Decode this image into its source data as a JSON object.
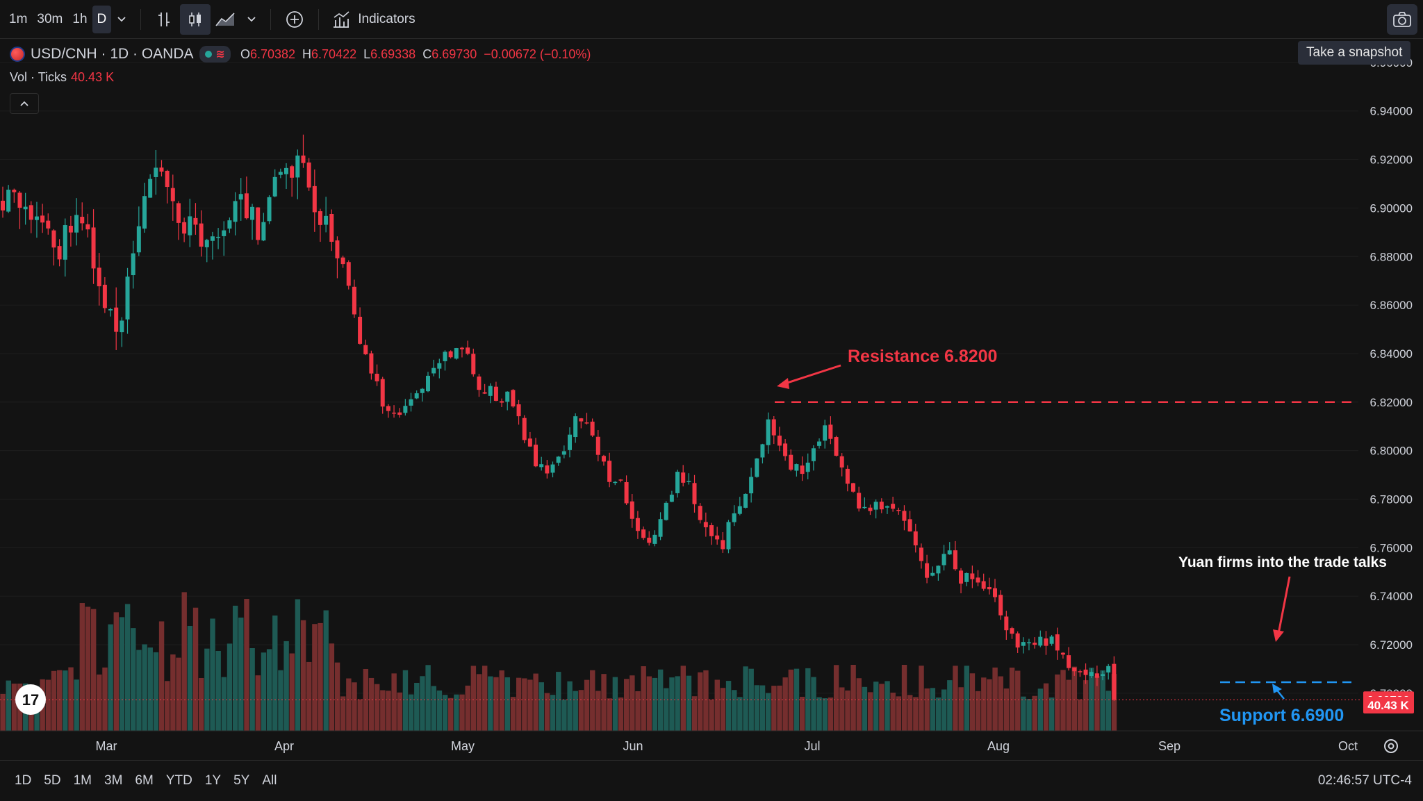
{
  "toolbar": {
    "timeframes": [
      "1m",
      "30m",
      "1h",
      "D"
    ],
    "active_timeframe": "D",
    "indicators_label": "Indicators",
    "snapshot_tooltip": "Take a snapshot"
  },
  "legend": {
    "symbol": "USD/CNH · 1D · OANDA",
    "open_label": "O",
    "open": "6.70382",
    "high_label": "H",
    "high": "6.70422",
    "low_label": "L",
    "low": "6.69338",
    "close_label": "C",
    "close": "6.69730",
    "change": "−0.00672 (−0.10%)",
    "volume_label": "Vol · Ticks",
    "volume_value": "40.43 K"
  },
  "bottom_bar": {
    "ranges": [
      "1D",
      "5D",
      "1M",
      "3M",
      "6M",
      "YTD",
      "1Y",
      "5Y",
      "All"
    ],
    "clock": "02:46:57 UTC-4"
  },
  "colors": {
    "up": "#26a69a",
    "down": "#f23645",
    "background": "#131313",
    "support": "#2196f3",
    "resistance": "#f23645"
  },
  "chart_data": {
    "type": "candlestick",
    "symbol": "USD/CNH",
    "interval": "1D",
    "source": "OANDA",
    "x_months": [
      "Mar",
      "Apr",
      "May",
      "Jun",
      "Jul",
      "Aug",
      "Sep",
      "Oct"
    ],
    "y_ticks": [
      "6.96000",
      "6.94000",
      "6.92000",
      "6.90000",
      "6.88000",
      "6.86000",
      "6.84000",
      "6.82000",
      "6.80000",
      "6.78000",
      "6.76000",
      "6.74000",
      "6.72000",
      "6.70000"
    ],
    "ylim": [
      6.6845,
      6.9697
    ],
    "last_price": "6.69730",
    "last_volume": "40.43 K",
    "close_path": [
      [
        0,
        6.905
      ],
      [
        4,
        6.895
      ],
      [
        10,
        6.885
      ],
      [
        14,
        6.894
      ],
      [
        18,
        6.862
      ],
      [
        20,
        6.848
      ],
      [
        22,
        6.872
      ],
      [
        26,
        6.915
      ],
      [
        31,
        6.898
      ],
      [
        36,
        6.888
      ],
      [
        41,
        6.902
      ],
      [
        45,
        6.892
      ],
      [
        49,
        6.915
      ],
      [
        52,
        6.921
      ],
      [
        55,
        6.9
      ],
      [
        58,
        6.887
      ],
      [
        60,
        6.875
      ],
      [
        62,
        6.857
      ],
      [
        64,
        6.837
      ],
      [
        66,
        6.827
      ],
      [
        68,
        6.815
      ],
      [
        70,
        6.812
      ],
      [
        72,
        6.82
      ],
      [
        75,
        6.83
      ],
      [
        78,
        6.838
      ],
      [
        81,
        6.842
      ],
      [
        84,
        6.827
      ],
      [
        87,
        6.823
      ],
      [
        89,
        6.822
      ],
      [
        91,
        6.812
      ],
      [
        93,
        6.8
      ],
      [
        95,
        6.793
      ],
      [
        97,
        6.792
      ],
      [
        99,
        6.8
      ],
      [
        101,
        6.815
      ],
      [
        103,
        6.812
      ],
      [
        105,
        6.8
      ],
      [
        107,
        6.79
      ],
      [
        109,
        6.787
      ],
      [
        111,
        6.774
      ],
      [
        113,
        6.763
      ],
      [
        115,
        6.764
      ],
      [
        117,
        6.776
      ],
      [
        119,
        6.79
      ],
      [
        121,
        6.785
      ],
      [
        123,
        6.772
      ],
      [
        125,
        6.764
      ],
      [
        127,
        6.762
      ],
      [
        129,
        6.775
      ],
      [
        131,
        6.78
      ],
      [
        133,
        6.797
      ],
      [
        135,
        6.812
      ],
      [
        137,
        6.805
      ],
      [
        139,
        6.795
      ],
      [
        141,
        6.79
      ],
      [
        143,
        6.8
      ],
      [
        145,
        6.808
      ],
      [
        147,
        6.798
      ],
      [
        149,
        6.786
      ],
      [
        151,
        6.776
      ],
      [
        153,
        6.777
      ],
      [
        155,
        6.775
      ],
      [
        157,
        6.776
      ],
      [
        159,
        6.77
      ],
      [
        161,
        6.763
      ],
      [
        163,
        6.75
      ],
      [
        165,
        6.752
      ],
      [
        167,
        6.758
      ],
      [
        169,
        6.748
      ],
      [
        171,
        6.749
      ],
      [
        173,
        6.746
      ],
      [
        175,
        6.742
      ],
      [
        177,
        6.726
      ],
      [
        179,
        6.721
      ],
      [
        181,
        6.72
      ],
      [
        183,
        6.722
      ],
      [
        185,
        6.722
      ],
      [
        187,
        6.714
      ],
      [
        189,
        6.708
      ],
      [
        191,
        6.705
      ],
      [
        193,
        6.709
      ],
      [
        195,
        6.711
      ],
      [
        196,
        6.697
      ]
    ],
    "series_count": 197,
    "annotations": [
      {
        "text": "Resistance 6.8200",
        "level": 6.82,
        "color": "#f23645"
      },
      {
        "text": "Support 6.6900",
        "level": 6.69,
        "color": "#2196f3"
      },
      {
        "text": "Yuan firms into the trade talks",
        "color": "#ffffff"
      }
    ]
  }
}
